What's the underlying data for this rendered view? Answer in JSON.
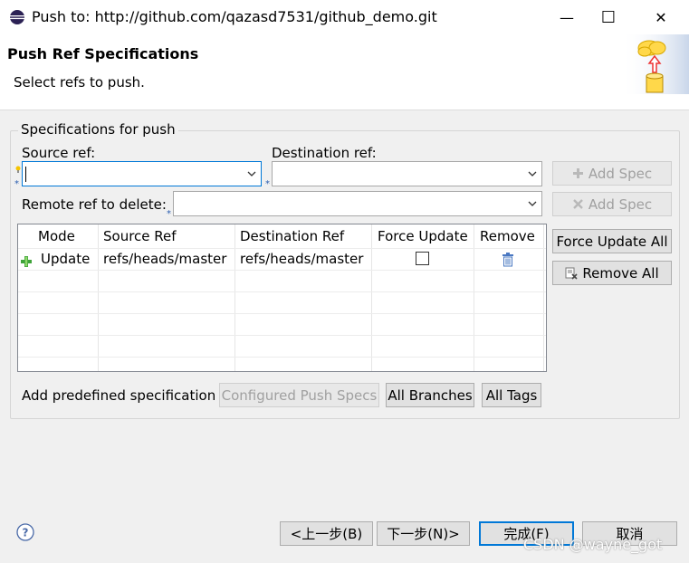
{
  "window": {
    "title": "Push to: http://github.com/qazasd7531/github_demo.git",
    "minimize_glyph": "—",
    "maximize_glyph": "☐",
    "close_glyph": "✕"
  },
  "header": {
    "title": "Push Ref Specifications",
    "subtitle": "Select refs to push."
  },
  "group": {
    "title": "Specifications for push",
    "source_label": "Source ref:",
    "source_value": "",
    "destination_label": "Destination ref:",
    "destination_value": "",
    "add_spec_label": "Add Spec",
    "remote_delete_label": "Remote ref to delete:",
    "remote_delete_value": "",
    "add_delete_spec_label": "Add Spec",
    "force_update_all_label": "Force Update All",
    "remove_all_label": "Remove All"
  },
  "table": {
    "columns": [
      "Mode",
      "Source Ref",
      "Destination Ref",
      "Force Update",
      "Remove"
    ],
    "rows": [
      {
        "mode": "Update",
        "source": "refs/heads/master",
        "destination": "refs/heads/master",
        "force_update": false
      }
    ]
  },
  "predefined": {
    "label": "Add predefined specification",
    "configured": "Configured Push Specs",
    "all_branches": "All Branches",
    "all_tags": "All Tags"
  },
  "footer": {
    "back": "<上一步(B)",
    "next": "下一步(N)>",
    "finish": "完成(F)",
    "cancel": "取消"
  },
  "watermark": "CSDN @wayne_got",
  "icons": {
    "app": "eclipse-icon",
    "header": "push-cloud-database-icon",
    "add": "plus-icon",
    "delete": "x-icon",
    "mode_update": "green-plus-icon",
    "remove": "trash-icon",
    "remove_all": "remove-all-icon",
    "help": "help-icon"
  },
  "colors": {
    "green": "#3fa33a",
    "trash_blue": "#4a78c2",
    "accent_border": "#0078d7",
    "header_arrow": "#e33"
  }
}
